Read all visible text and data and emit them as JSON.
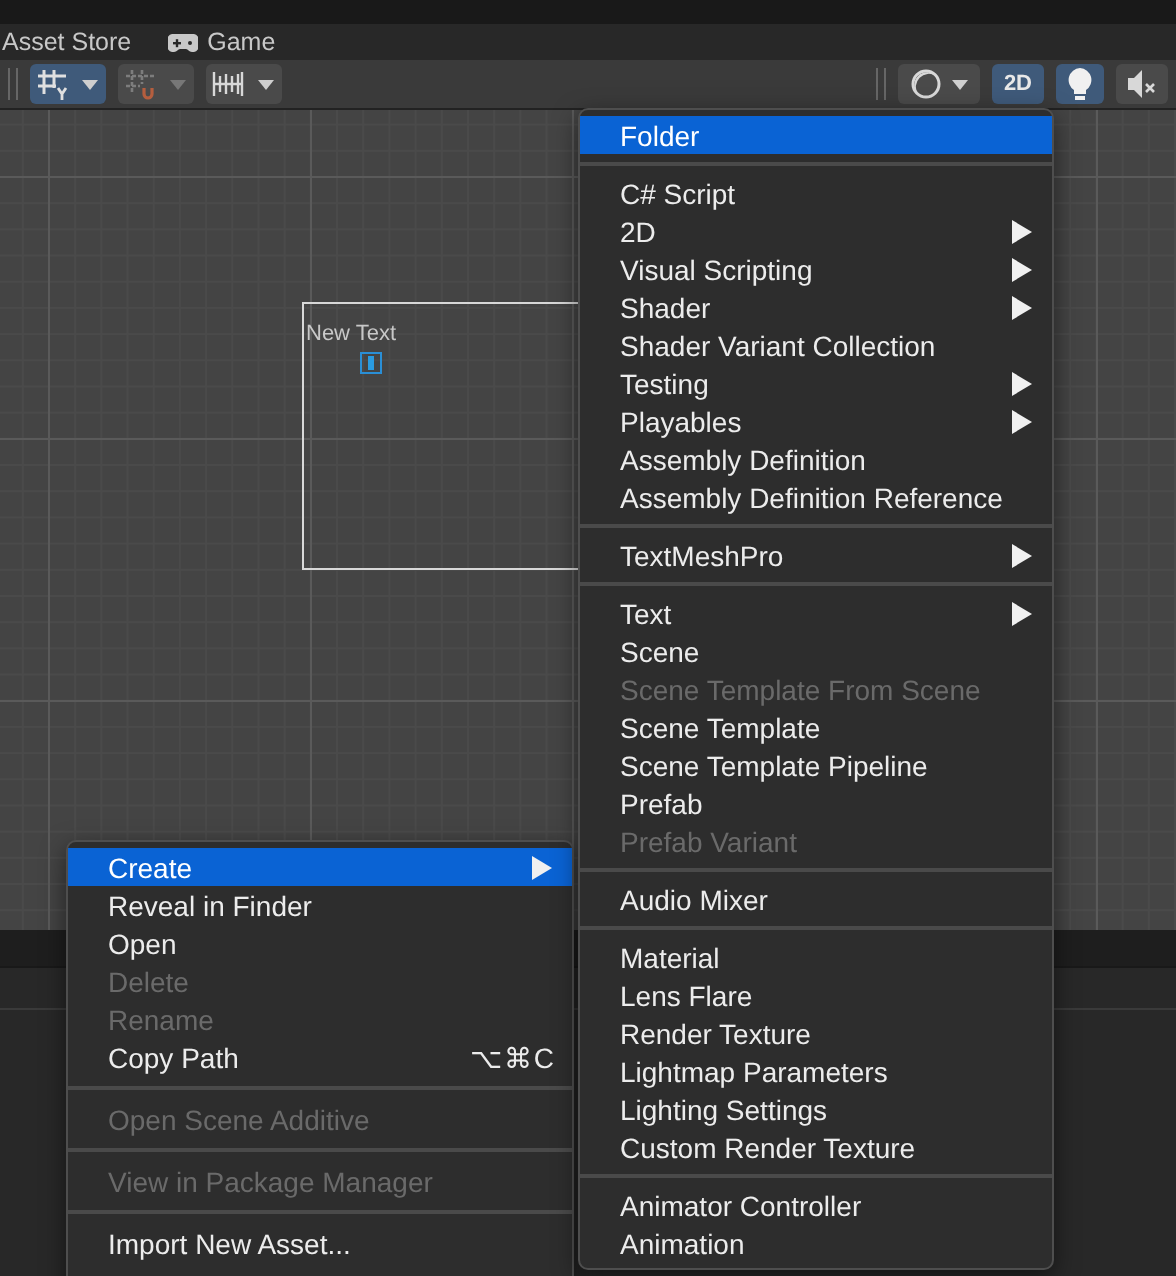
{
  "tabs": [
    {
      "label": "Asset Store",
      "selected": false
    },
    {
      "label": "Game",
      "selected": false
    }
  ],
  "toolbar": {
    "left": [
      {
        "selected": true,
        "disabled": false
      },
      {
        "selected": false,
        "disabled": true
      },
      {
        "selected": false,
        "disabled": false
      }
    ],
    "right": [
      {
        "kind": "icon",
        "caret": true,
        "selected": false
      },
      {
        "kind": "text",
        "label": "2D",
        "caret": false,
        "selected": true
      },
      {
        "kind": "icon",
        "caret": false,
        "selected": true
      },
      {
        "kind": "icon",
        "caret": false,
        "selected": false
      }
    ]
  },
  "scene": {
    "text_object": "New Text"
  },
  "context_menu": {
    "items": [
      {
        "kind": "item",
        "label": "Create",
        "selected": true,
        "disabled": false,
        "submenu": true
      },
      {
        "kind": "item",
        "label": "Reveal in Finder",
        "selected": false,
        "disabled": false,
        "submenu": false
      },
      {
        "kind": "item",
        "label": "Open",
        "selected": false,
        "disabled": false,
        "submenu": false
      },
      {
        "kind": "item",
        "label": "Delete",
        "selected": false,
        "disabled": true,
        "submenu": false
      },
      {
        "kind": "item",
        "label": "Rename",
        "selected": false,
        "disabled": true,
        "submenu": false
      },
      {
        "kind": "item",
        "label": "Copy Path",
        "selected": false,
        "disabled": false,
        "submenu": false,
        "shortcut": "⌥⌘C"
      },
      {
        "kind": "separator"
      },
      {
        "kind": "item",
        "label": "Open Scene Additive",
        "selected": false,
        "disabled": true,
        "submenu": false
      },
      {
        "kind": "separator"
      },
      {
        "kind": "item",
        "label": "View in Package Manager",
        "selected": false,
        "disabled": true,
        "submenu": false
      },
      {
        "kind": "separator"
      },
      {
        "kind": "item",
        "label": "Import New Asset...",
        "selected": false,
        "disabled": false,
        "submenu": false
      }
    ]
  },
  "create_submenu": {
    "items": [
      {
        "kind": "item",
        "label": "Folder",
        "selected": true,
        "disabled": false,
        "submenu": false
      },
      {
        "kind": "separator"
      },
      {
        "kind": "item",
        "label": "C# Script",
        "selected": false,
        "disabled": false,
        "submenu": false
      },
      {
        "kind": "item",
        "label": "2D",
        "selected": false,
        "disabled": false,
        "submenu": true
      },
      {
        "kind": "item",
        "label": "Visual Scripting",
        "selected": false,
        "disabled": false,
        "submenu": true
      },
      {
        "kind": "item",
        "label": "Shader",
        "selected": false,
        "disabled": false,
        "submenu": true
      },
      {
        "kind": "item",
        "label": "Shader Variant Collection",
        "selected": false,
        "disabled": false,
        "submenu": false
      },
      {
        "kind": "item",
        "label": "Testing",
        "selected": false,
        "disabled": false,
        "submenu": true
      },
      {
        "kind": "item",
        "label": "Playables",
        "selected": false,
        "disabled": false,
        "submenu": true
      },
      {
        "kind": "item",
        "label": "Assembly Definition",
        "selected": false,
        "disabled": false,
        "submenu": false
      },
      {
        "kind": "item",
        "label": "Assembly Definition Reference",
        "selected": false,
        "disabled": false,
        "submenu": false
      },
      {
        "kind": "separator"
      },
      {
        "kind": "item",
        "label": "TextMeshPro",
        "selected": false,
        "disabled": false,
        "submenu": true
      },
      {
        "kind": "separator"
      },
      {
        "kind": "item",
        "label": "Text",
        "selected": false,
        "disabled": false,
        "submenu": true
      },
      {
        "kind": "item",
        "label": "Scene",
        "selected": false,
        "disabled": false,
        "submenu": false
      },
      {
        "kind": "item",
        "label": "Scene Template From Scene",
        "selected": false,
        "disabled": true,
        "submenu": false
      },
      {
        "kind": "item",
        "label": "Scene Template",
        "selected": false,
        "disabled": false,
        "submenu": false
      },
      {
        "kind": "item",
        "label": "Scene Template Pipeline",
        "selected": false,
        "disabled": false,
        "submenu": false
      },
      {
        "kind": "item",
        "label": "Prefab",
        "selected": false,
        "disabled": false,
        "submenu": false
      },
      {
        "kind": "item",
        "label": "Prefab Variant",
        "selected": false,
        "disabled": true,
        "submenu": false
      },
      {
        "kind": "separator"
      },
      {
        "kind": "item",
        "label": "Audio Mixer",
        "selected": false,
        "disabled": false,
        "submenu": false
      },
      {
        "kind": "separator"
      },
      {
        "kind": "item",
        "label": "Material",
        "selected": false,
        "disabled": false,
        "submenu": false
      },
      {
        "kind": "item",
        "label": "Lens Flare",
        "selected": false,
        "disabled": false,
        "submenu": false
      },
      {
        "kind": "item",
        "label": "Render Texture",
        "selected": false,
        "disabled": false,
        "submenu": false
      },
      {
        "kind": "item",
        "label": "Lightmap Parameters",
        "selected": false,
        "disabled": false,
        "submenu": false
      },
      {
        "kind": "item",
        "label": "Lighting Settings",
        "selected": false,
        "disabled": false,
        "submenu": false
      },
      {
        "kind": "item",
        "label": "Custom Render Texture",
        "selected": false,
        "disabled": false,
        "submenu": false
      },
      {
        "kind": "separator"
      },
      {
        "kind": "item",
        "label": "Animator Controller",
        "selected": false,
        "disabled": false,
        "submenu": false
      },
      {
        "kind": "item",
        "label": "Animation",
        "selected": false,
        "disabled": false,
        "submenu": false
      }
    ]
  }
}
